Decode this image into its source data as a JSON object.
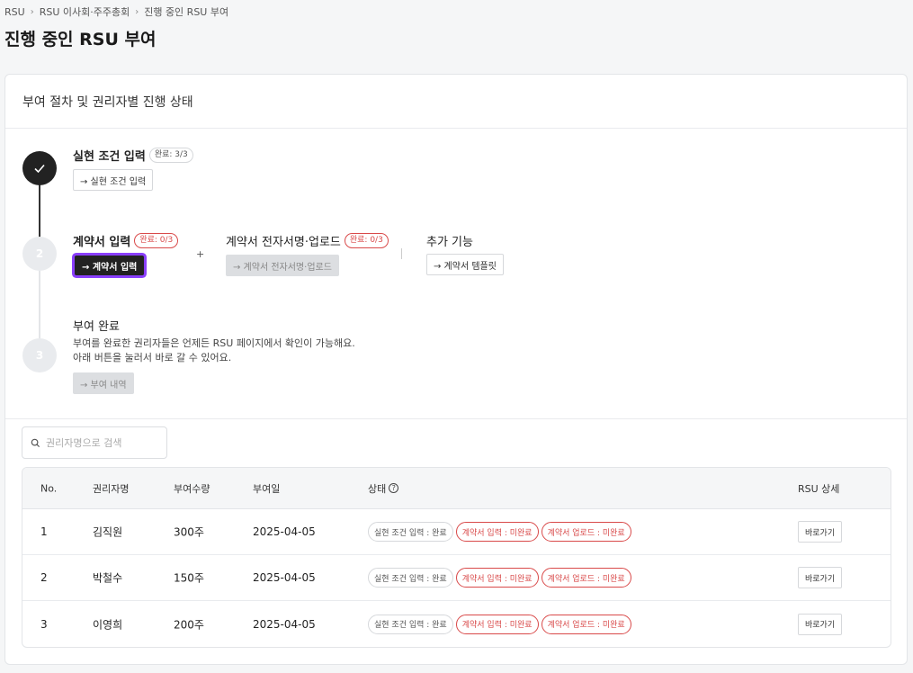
{
  "breadcrumb": [
    "RSU",
    "RSU 이사회·주주총회",
    "진행 중인 RSU 부여"
  ],
  "page_title": "진행 중인 RSU 부여",
  "card": {
    "title": "부여 절차 및 권리자별 진행 상태",
    "step1": {
      "title": "실현 조건 입력",
      "badge": "완료: 3/3",
      "button": "→ 실현 조건 입력"
    },
    "step2": {
      "number": "2",
      "part1": {
        "title": "계약서 입력",
        "badge": "완료: 0/3",
        "button": "→ 계약서 입력"
      },
      "plus": "+",
      "part2": {
        "title": "계약서 전자서명·업로드",
        "badge": "완료: 0/3",
        "button": "→ 계약서 전자서명·업로드"
      },
      "part3": {
        "title": "추가 기능",
        "button": "→ 계약서 템플릿"
      }
    },
    "step3": {
      "number": "3",
      "title": "부여 완료",
      "desc1": "부여를 완료한 권리자들은 언제든 RSU 페이지에서 확인이 가능해요.",
      "desc2": "아래 버튼을 눌러서 바로 갈 수 있어요.",
      "button": "→ 부여 내역"
    }
  },
  "search": {
    "placeholder": "권리자명으로 검색",
    "value": ""
  },
  "table": {
    "headers": {
      "no": "No.",
      "name": "권리자명",
      "qty": "부여수량",
      "date": "부여일",
      "status": "상태",
      "detail": "RSU 상세"
    },
    "rows": [
      {
        "no": "1",
        "name": "김직원",
        "qty": "300주",
        "date": "2025-04-05",
        "s1": "실현 조건 입력 : 완료",
        "s2": "계약서 입력 : 미완료",
        "s3": "계약서 업로드 : 미완료",
        "action": "바로가기"
      },
      {
        "no": "2",
        "name": "박철수",
        "qty": "150주",
        "date": "2025-04-05",
        "s1": "실현 조건 입력 : 완료",
        "s2": "계약서 입력 : 미완료",
        "s3": "계약서 업로드 : 미완료",
        "action": "바로가기"
      },
      {
        "no": "3",
        "name": "이영희",
        "qty": "200주",
        "date": "2025-04-05",
        "s1": "실현 조건 입력 : 완료",
        "s2": "계약서 입력 : 미완료",
        "s3": "계약서 업로드 : 미완료",
        "action": "바로가기"
      }
    ]
  },
  "colors": {
    "accent_focus": "#8a3ffc",
    "danger": "#d94a4a",
    "dark": "#222222"
  }
}
